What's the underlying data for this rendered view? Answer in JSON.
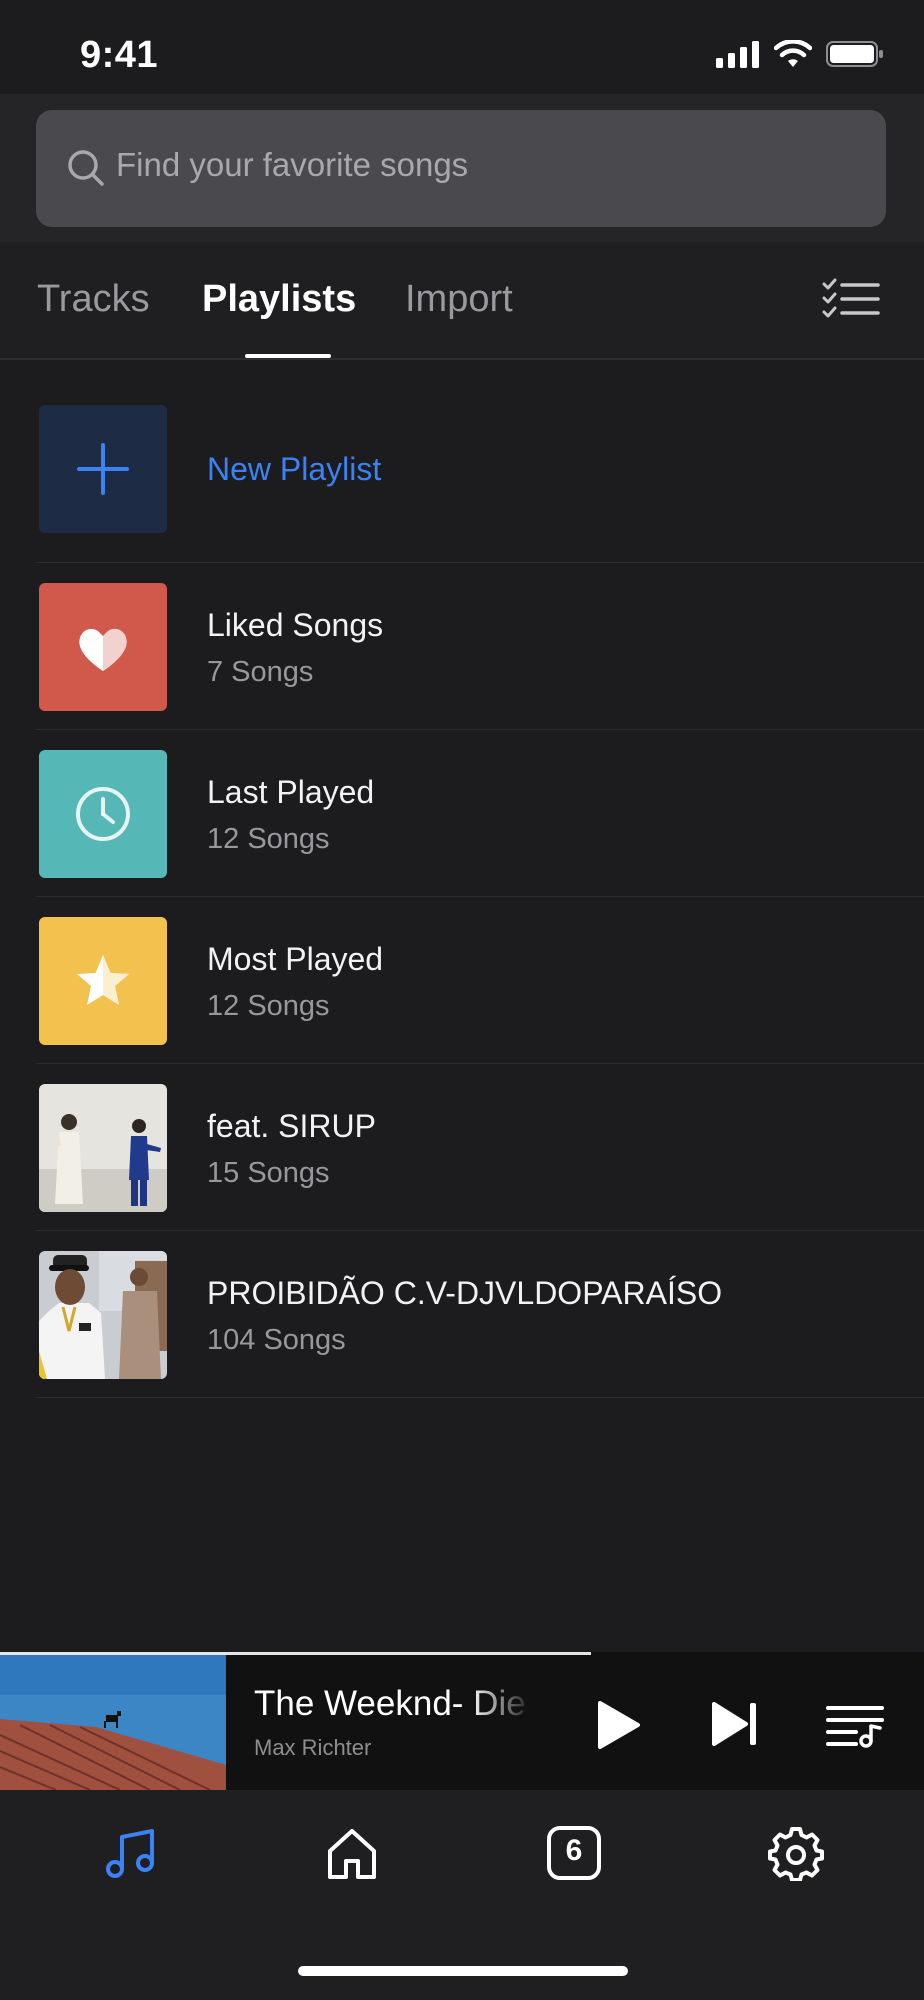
{
  "status_bar": {
    "time": "9:41"
  },
  "search": {
    "placeholder": "Find your favorite songs"
  },
  "tabs": [
    {
      "label": "Tracks",
      "active": false
    },
    {
      "label": "Playlists",
      "active": true
    },
    {
      "label": "Import",
      "active": false
    }
  ],
  "playlists": {
    "new_playlist_label": "New Playlist",
    "items": [
      {
        "title": "Liked Songs",
        "count": "7 Songs",
        "icon": "heart-icon",
        "color": "#d0594b"
      },
      {
        "title": "Last Played",
        "count": "12 Songs",
        "icon": "clock-icon",
        "color": "#56b8b6"
      },
      {
        "title": "Most Played",
        "count": "12 Songs",
        "icon": "star-icon",
        "color": "#f2c14e"
      },
      {
        "title": "feat. SIRUP",
        "count": "15 Songs",
        "icon": "album-art"
      },
      {
        "title": "PROIBIDÃO C.V-DJVLDOPARAÍSO",
        "count": "104 Songs",
        "icon": "album-art"
      }
    ]
  },
  "now_playing": {
    "title": "The Weeknd- Die",
    "artist": "Max Richter",
    "progress": 0.64
  },
  "bottom_nav": [
    {
      "name": "music",
      "icon": "music-note-icon",
      "active": true
    },
    {
      "name": "home",
      "icon": "home-icon",
      "active": false
    },
    {
      "name": "queue",
      "icon": "counter-badge-icon",
      "badge": "6",
      "active": false
    },
    {
      "name": "settings",
      "icon": "gear-icon",
      "active": false
    }
  ],
  "colors": {
    "accent": "#3b82f6",
    "background": "#1c1c1e"
  }
}
